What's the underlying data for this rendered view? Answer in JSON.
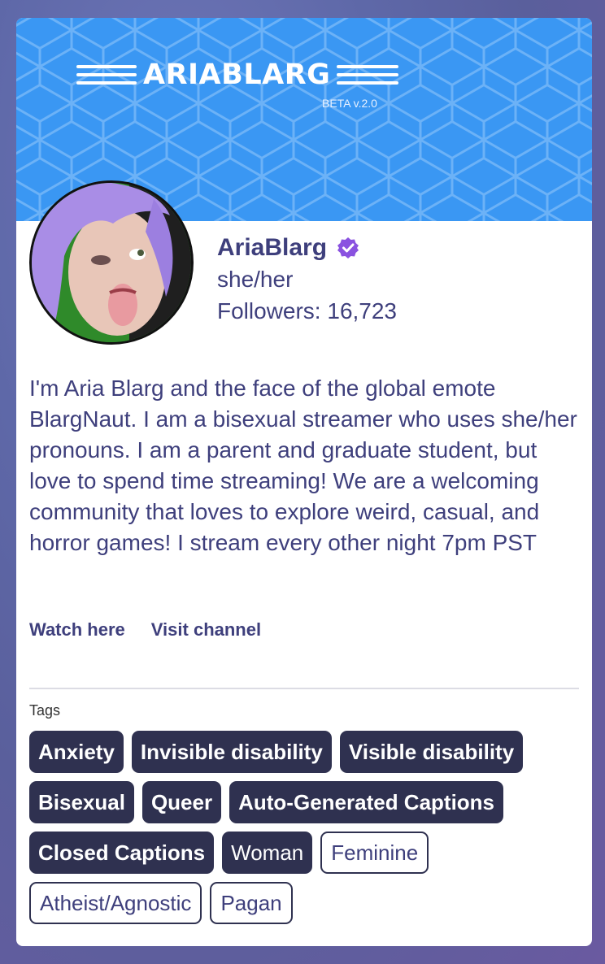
{
  "brand": {
    "logo_text": "ARIABLARG",
    "beta_label": "BETA v.2.0",
    "banner_color": "#3a97f3"
  },
  "profile": {
    "name": "AriaBlarg",
    "verified_icon": "verified-badge-icon",
    "verified_color": "#8a52e0",
    "pronouns": "she/her",
    "followers_label": "Followers: 16,723",
    "bio": "I'm Aria Blarg and the face of the global emote BlargNaut. I am a bisexual streamer who uses she/her pronouns. I am a parent and graduate student, but love to spend time streaming! We are a welcoming community that loves to explore weird, casual, and horror games! I stream every other night 7pm PST"
  },
  "links": {
    "watch": "Watch here",
    "visit": "Visit channel"
  },
  "tags": {
    "label": "Tags",
    "items": [
      {
        "label": "Anxiety",
        "style": "filled"
      },
      {
        "label": "Invisible disability",
        "style": "filled"
      },
      {
        "label": "Visible disability",
        "style": "filled"
      },
      {
        "label": "Bisexual",
        "style": "filled"
      },
      {
        "label": "Queer",
        "style": "filled"
      },
      {
        "label": "Auto-Generated Captions",
        "style": "filled"
      },
      {
        "label": "Closed Captions",
        "style": "filled"
      },
      {
        "label": "Woman",
        "style": "filled-light"
      },
      {
        "label": "Feminine",
        "style": "outline"
      },
      {
        "label": "Atheist/Agnostic",
        "style": "outline"
      },
      {
        "label": "Pagan",
        "style": "outline"
      }
    ]
  }
}
